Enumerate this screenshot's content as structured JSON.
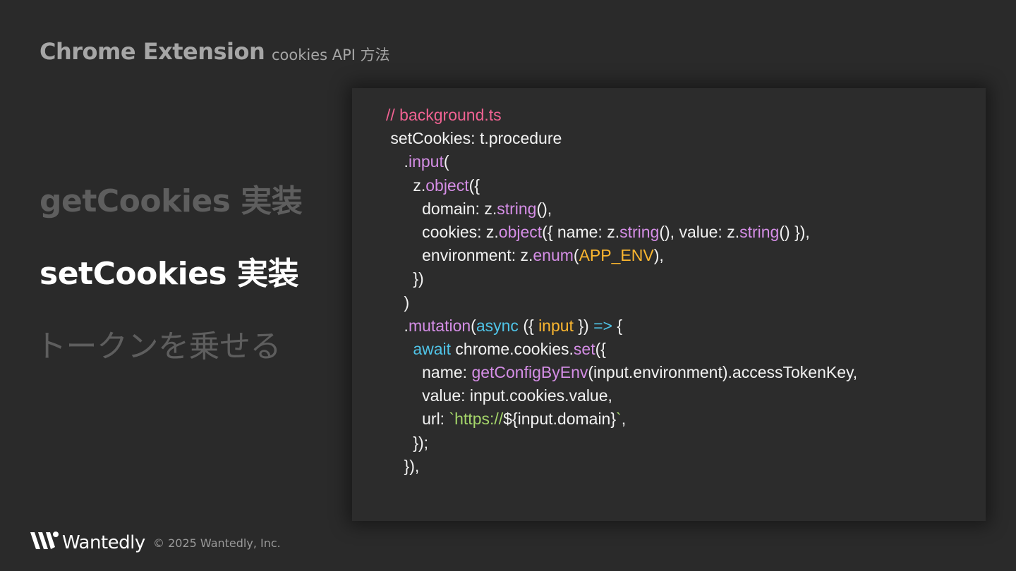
{
  "header": {
    "title": "Chrome Extension",
    "subtitle": "cookies API 方法"
  },
  "nav": {
    "items": [
      {
        "label": "getCookies 実装",
        "state": "inactive"
      },
      {
        "label": "setCookies 実装",
        "state": "active"
      },
      {
        "label": "トークンを乗せる",
        "state": "inactive"
      }
    ]
  },
  "code": {
    "lines": [
      [
        {
          "t": "// background.ts",
          "c": "comment"
        }
      ],
      [
        {
          "t": " setCookies: t.procedure",
          "c": "plain"
        }
      ],
      [
        {
          "t": "    .",
          "c": "plain"
        },
        {
          "t": "input",
          "c": "purple"
        },
        {
          "t": "(",
          "c": "plain"
        }
      ],
      [
        {
          "t": "      z.",
          "c": "plain"
        },
        {
          "t": "object",
          "c": "purple"
        },
        {
          "t": "({",
          "c": "plain"
        }
      ],
      [
        {
          "t": "        domain: z.",
          "c": "plain"
        },
        {
          "t": "string",
          "c": "purple"
        },
        {
          "t": "(),",
          "c": "plain"
        }
      ],
      [
        {
          "t": "        cookies: z.",
          "c": "plain"
        },
        {
          "t": "object",
          "c": "purple"
        },
        {
          "t": "({ name: z.",
          "c": "plain"
        },
        {
          "t": "string",
          "c": "purple"
        },
        {
          "t": "(), value: z.",
          "c": "plain"
        },
        {
          "t": "string",
          "c": "purple"
        },
        {
          "t": "() }),",
          "c": "plain"
        }
      ],
      [
        {
          "t": "        environment: z.",
          "c": "plain"
        },
        {
          "t": "enum",
          "c": "purple"
        },
        {
          "t": "(",
          "c": "plain"
        },
        {
          "t": "APP_ENV",
          "c": "yellow"
        },
        {
          "t": "),",
          "c": "plain"
        }
      ],
      [
        {
          "t": "      })",
          "c": "plain"
        }
      ],
      [
        {
          "t": "    )",
          "c": "plain"
        }
      ],
      [
        {
          "t": "    .",
          "c": "plain"
        },
        {
          "t": "mutation",
          "c": "purple"
        },
        {
          "t": "(",
          "c": "plain"
        },
        {
          "t": "async",
          "c": "cyan"
        },
        {
          "t": " ({ ",
          "c": "plain"
        },
        {
          "t": "input",
          "c": "yellow"
        },
        {
          "t": " }) ",
          "c": "plain"
        },
        {
          "t": "=>",
          "c": "cyan"
        },
        {
          "t": " {",
          "c": "plain"
        }
      ],
      [
        {
          "t": "      ",
          "c": "plain"
        },
        {
          "t": "await",
          "c": "cyan"
        },
        {
          "t": " chrome.cookies.",
          "c": "plain"
        },
        {
          "t": "set",
          "c": "purple"
        },
        {
          "t": "({",
          "c": "plain"
        }
      ],
      [
        {
          "t": "        name: ",
          "c": "plain"
        },
        {
          "t": "getConfigByEnv",
          "c": "purple"
        },
        {
          "t": "(input.environment).accessTokenKey,",
          "c": "plain"
        }
      ],
      [
        {
          "t": "        value: input.cookies.value,",
          "c": "plain"
        }
      ],
      [
        {
          "t": "        url: ",
          "c": "plain"
        },
        {
          "t": "`https://",
          "c": "green"
        },
        {
          "t": "${input.domain}",
          "c": "plain"
        },
        {
          "t": "`",
          "c": "green"
        },
        {
          "t": ",",
          "c": "plain"
        }
      ],
      [
        {
          "t": "      });",
          "c": "plain"
        }
      ],
      [
        {
          "t": "    }),",
          "c": "plain"
        }
      ]
    ]
  },
  "footer": {
    "brand": "Wantedly",
    "copyright": "© 2025 Wantedly, Inc.",
    "logo_icon": "wantedly-w-icon"
  },
  "colors": {
    "background": "#2a2a2a",
    "code_panel": "#2c2c2c",
    "comment": "#f06292",
    "keyword_purple": "#d58ee6",
    "keyword_cyan": "#4fc3e6",
    "constant_yellow": "#fbb62f",
    "string_green": "#a5d66a",
    "muted_text": "#5e5e5e"
  }
}
